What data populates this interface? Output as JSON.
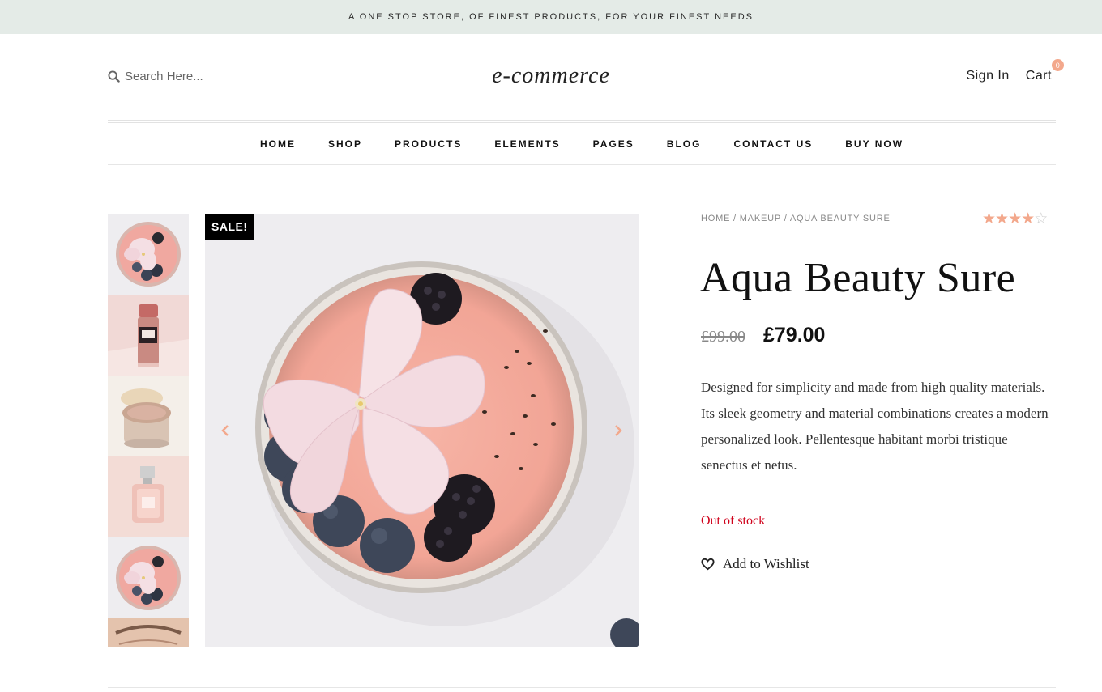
{
  "topbar": {
    "text": "A ONE STOP STORE, OF FINEST PRODUCTS, FOR YOUR FINEST NEEDS"
  },
  "header": {
    "search_placeholder": "Search Here...",
    "logo": "e-commerce",
    "sign_in": "Sign In",
    "cart_label": "Cart",
    "cart_count": "0"
  },
  "nav": {
    "items": [
      "HOME",
      "SHOP",
      "PRODUCTS",
      "ELEMENTS",
      "PAGES",
      "BLOG",
      "CONTACT US",
      "BUY NOW"
    ]
  },
  "gallery": {
    "sale_badge": "SALE!",
    "thumbnails": [
      "flower-smoothie-bowl",
      "lipstick",
      "face-powder-jar",
      "perfume-bottle",
      "flower-smoothie-bowl",
      "eye-closeup"
    ]
  },
  "product": {
    "breadcrumb": {
      "home": "HOME",
      "category": "MAKEUP",
      "current": "AQUA BEAUTY SURE",
      "sep": " / "
    },
    "rating": 4,
    "rating_max": 5,
    "title": "Aqua Beauty Sure",
    "old_price": "£99.00",
    "price": "£79.00",
    "description": "Designed for simplicity and made from high quality materials. Its sleek geometry and material combinations creates a modern personalized look. Pellentesque habitant morbi tristique senectus et netus.",
    "stock_status": "Out of stock",
    "wishlist_label": "Add to Wishlist"
  },
  "colors": {
    "accent": "#f3a88c",
    "topbar_bg": "#e4ebe7",
    "stock": "#d0021b"
  }
}
